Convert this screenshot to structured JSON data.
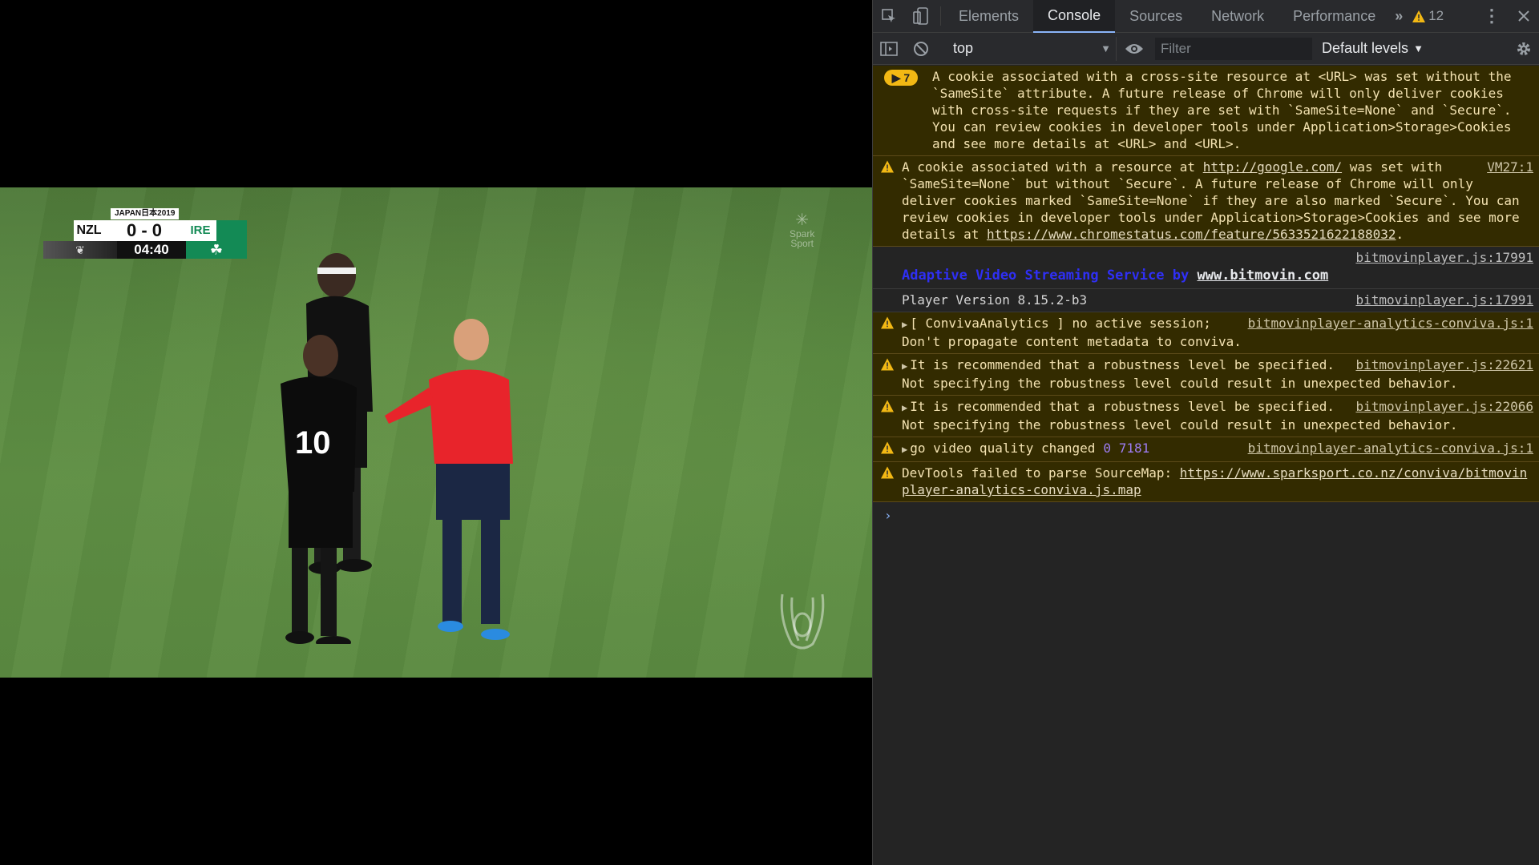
{
  "video": {
    "scoreboard": {
      "tournament": "JAPAN日本2019",
      "home": "NZL",
      "score": "0 - 0",
      "away": "IRE",
      "clock": "04:40"
    },
    "broadcaster": [
      "Spark",
      "Sport"
    ],
    "player_number": "10"
  },
  "devtools": {
    "tabs": [
      {
        "label": "Elements",
        "active": false
      },
      {
        "label": "Console",
        "active": true
      },
      {
        "label": "Sources",
        "active": false
      },
      {
        "label": "Network",
        "active": false
      },
      {
        "label": "Performance",
        "active": false
      }
    ],
    "more_tabs": "»",
    "warning_count": "12",
    "context": "top",
    "filter_placeholder": "Filter",
    "levels": "Default levels",
    "messages": {
      "m1": {
        "badge": "7",
        "text": "A cookie associated with a cross-site resource at <URL> was set without the `SameSite` attribute. A future release of Chrome will only deliver cookies with cross-site requests if they are set with `SameSite=None` and `Secure`. You can review cookies in developer tools under Application>Storage>Cookies and see more details at <URL> and <URL>."
      },
      "m2": {
        "src": "VM27:1",
        "pre": "A cookie associated with a resource at ",
        "link1": "http://google.com/",
        "mid": " was set with `SameSite=None` but without `Secure`. A future release of Chrome will only deliver cookies marked `SameSite=None` if they are also marked `Secure`. You can review cookies in developer tools under Application>Storage>Cookies and see more details at ",
        "link2": "https://www.chromestatus.com/feature/5633521622188032",
        "post": "."
      },
      "m3": {
        "src": "bitmovinplayer.js:17991",
        "text": "Adaptive Video Streaming Service by ",
        "url": "www.bitmovin.com"
      },
      "m4": {
        "src": "bitmovinplayer.js:17991",
        "text": "Player Version 8.15.2-b3"
      },
      "m5": {
        "src": "bitmovinplayer-analytics-conviva.js:1",
        "text": "[ ConvivaAnalytics ] no active session; Don't propagate content metadata to conviva."
      },
      "m6": {
        "src": "bitmovinplayer.js:22621",
        "text": "It is recommended that a robustness level be specified. Not specifying the robustness level could result in unexpected behavior."
      },
      "m7": {
        "src": "bitmovinplayer.js:22066",
        "text": "It is recommended that a robustness level be specified. Not specifying the robustness level could result in unexpected behavior."
      },
      "m8": {
        "src": "bitmovinplayer-analytics-conviva.js:1",
        "text": "go video quality changed",
        "nums": "0 7181"
      },
      "m9": {
        "text": "DevTools failed to parse SourceMap: ",
        "link": "https://www.sparksport.co.nz/conviva/bitmovinplayer-analytics-conviva.js.map"
      }
    },
    "prompt": "›"
  },
  "colors": {
    "warning_bg": "#332b00",
    "warning_text": "#f3e2b1",
    "badge": "#f2b814",
    "ire_green": "#138a55",
    "referee_red": "#e8242b"
  }
}
